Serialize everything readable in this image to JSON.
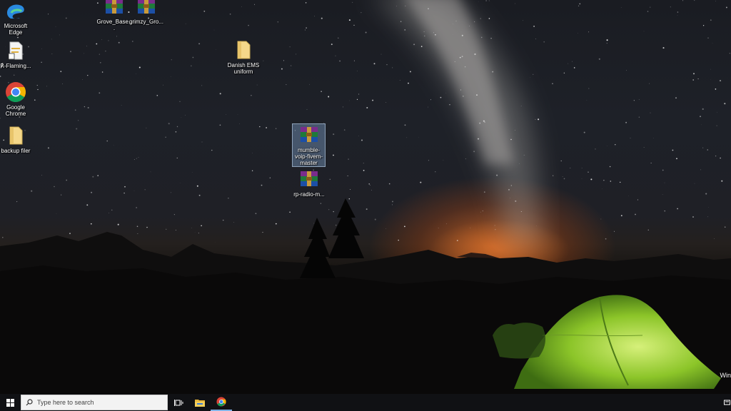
{
  "desktop": {
    "icons": [
      {
        "label": "Microsoft Edge",
        "icon": "edge-icon"
      },
      {
        "label": "Grove_Base...",
        "icon": "winrar-archive-icon"
      },
      {
        "label": "grimzy_Gro...",
        "icon": "winrar-archive-icon"
      },
      {
        "label": "℟-Flaming...",
        "icon": "text-document-icon"
      },
      {
        "label": "Danish EMS uniform",
        "icon": "folder-icon"
      },
      {
        "label": "Google Chrome",
        "icon": "chrome-icon"
      },
      {
        "label": "backup filer",
        "icon": "folder-icon"
      },
      {
        "label": "mumble-voip-fivem-master",
        "icon": "winrar-archive-icon",
        "selected": true
      },
      {
        "label": "rp-radio-m...",
        "icon": "winrar-archive-icon"
      }
    ],
    "watermark": "Win"
  },
  "taskbar": {
    "search_placeholder": "Type here to search",
    "buttons": [
      "start-icon",
      "task-view-icon",
      "file-explorer-icon",
      "chrome-icon"
    ],
    "accent": "#7fb2e6"
  }
}
